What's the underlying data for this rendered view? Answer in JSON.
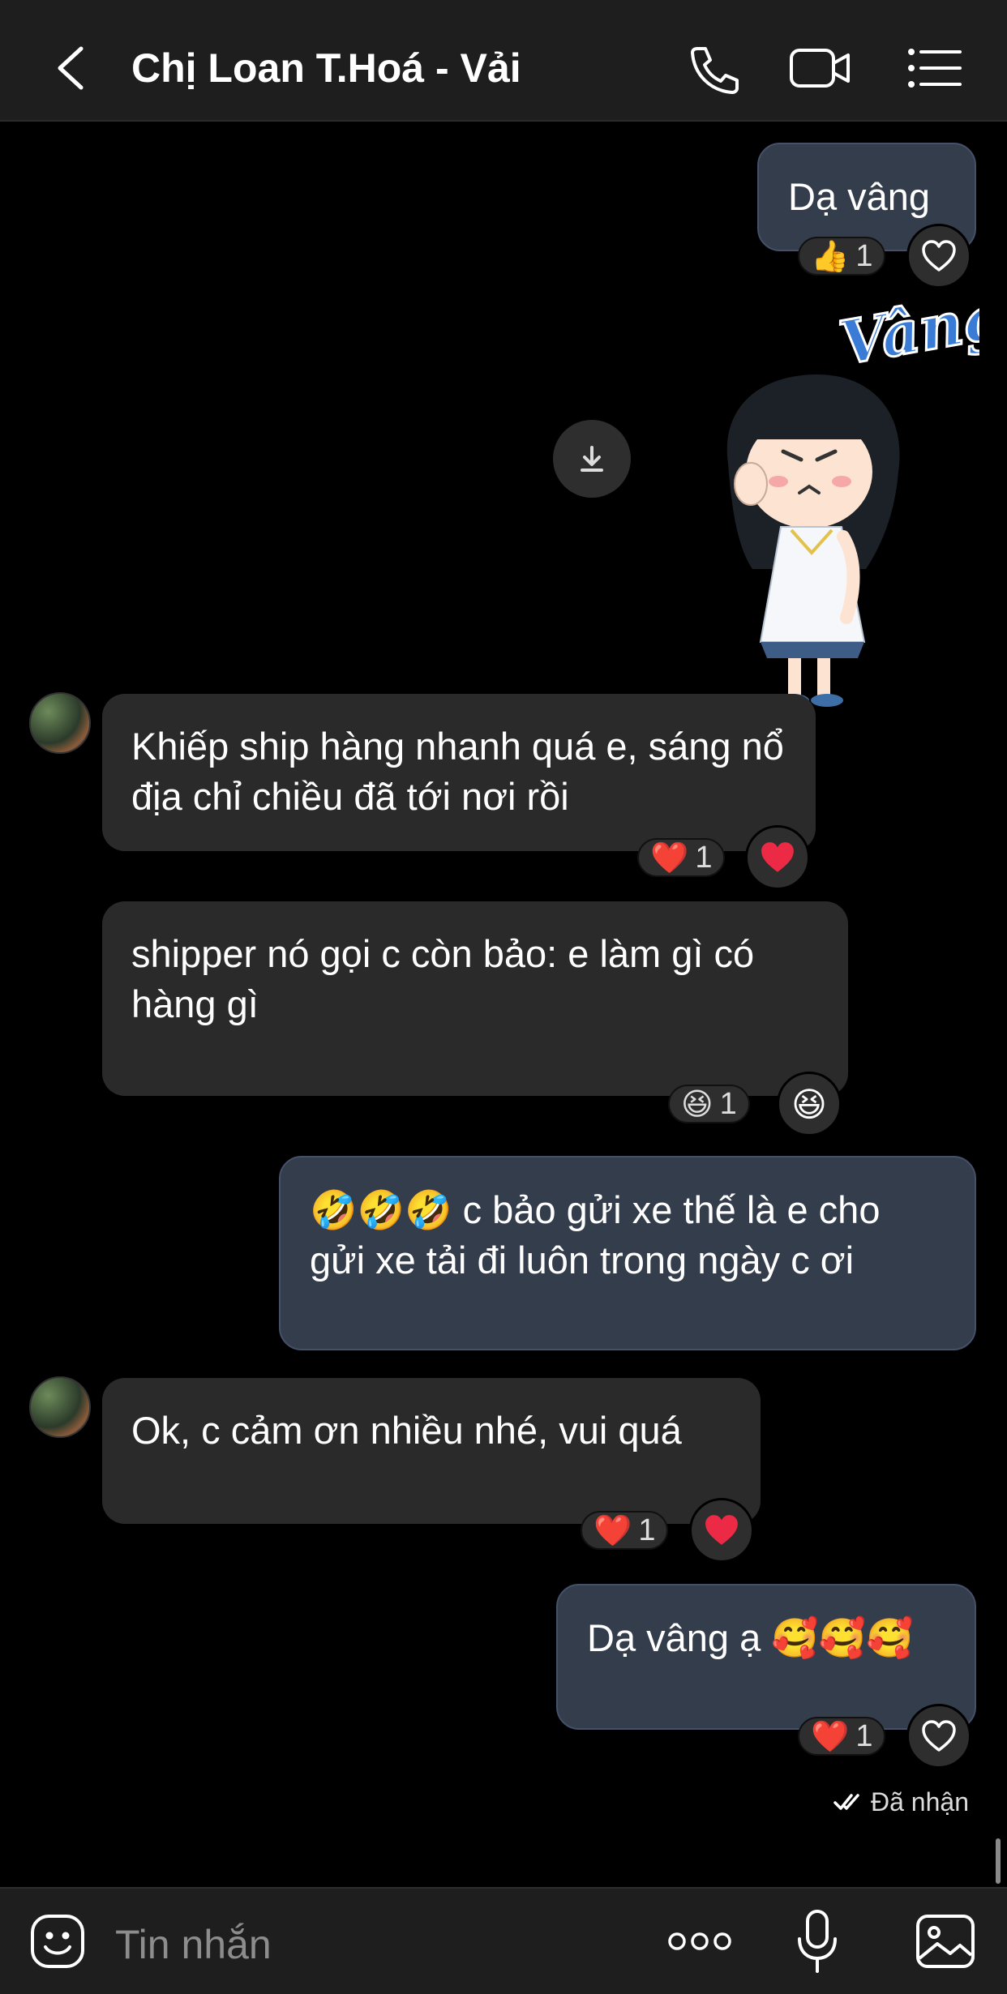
{
  "header": {
    "title": "Chị Loan T.Hoá - Vải",
    "back_icon": "chevron-left-icon",
    "call_icon": "phone-icon",
    "video_icon": "video-camera-icon",
    "menu_icon": "list-menu-icon"
  },
  "messages": [
    {
      "side": "out",
      "text": "Dạ vâng",
      "reaction_emoji": "👍",
      "reaction_count": "1",
      "react_button": "heart-outline"
    },
    {
      "side": "out",
      "type": "sticker",
      "sticker_text": "Vâng"
    },
    {
      "side": "in",
      "text": "Khiếp ship hàng nhanh quá e, sáng nổ địa chỉ chiều đã tới nơi rồi",
      "reaction_emoji": "❤️",
      "reaction_count": "1",
      "react_button": "❤️"
    },
    {
      "side": "in",
      "text": "shipper nó gọi c còn bảo: e làm gì có hàng gì",
      "reaction_emoji": "😆",
      "reaction_count": "1",
      "react_button": "😆"
    },
    {
      "side": "out",
      "text": "🤣🤣🤣 c bảo gửi xe thế là e cho gửi xe tải đi luôn trong ngày c ơi"
    },
    {
      "side": "in",
      "text": "Ok, c cảm ơn nhiều nhé, vui quá",
      "reaction_emoji": "❤️",
      "reaction_count": "1",
      "react_button": "❤️"
    },
    {
      "side": "out",
      "text": "Dạ vâng ạ 🥰🥰🥰",
      "reaction_emoji": "❤️",
      "reaction_count": "1",
      "react_button": "heart-outline"
    }
  ],
  "status": {
    "label": "Đã nhận"
  },
  "composer": {
    "placeholder": "Tin nhắn",
    "sticker_icon": "smiley-icon",
    "more_icon": "more-dots-icon",
    "mic_icon": "microphone-icon",
    "image_icon": "image-icon"
  },
  "colors": {
    "background": "#000000",
    "header": "#1e1e1e",
    "incoming_bubble": "#2a2a2a",
    "outgoing_bubble": "#343d4b",
    "sticker_text": "#3a7bd5"
  }
}
